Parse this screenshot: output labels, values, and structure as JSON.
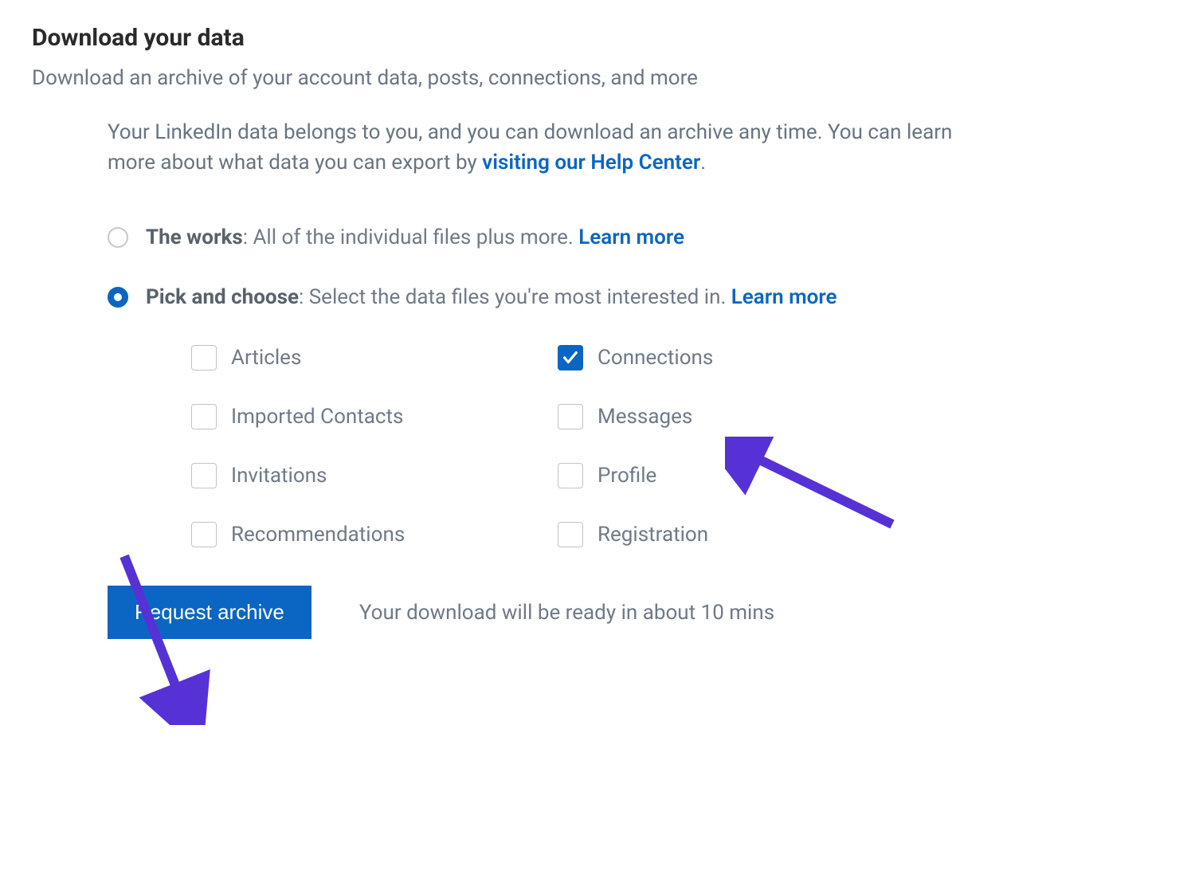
{
  "title": "Download your data",
  "subtitle": "Download an archive of your account data, posts, connections, and more",
  "intro_text_1": "Your LinkedIn data belongs to you, and you can download an archive any time. You can learn more about what data you can export by ",
  "intro_link": "visiting our Help Center",
  "intro_text_2": ".",
  "radio_options": [
    {
      "selected": false,
      "bold": "The works",
      "rest": ": All of the individual files plus more. ",
      "learn_more": "Learn more"
    },
    {
      "selected": true,
      "bold": "Pick and choose",
      "rest": ": Select the data files you're most interested in. ",
      "learn_more": "Learn more"
    }
  ],
  "checkboxes": [
    {
      "label": "Articles",
      "checked": false
    },
    {
      "label": "Connections",
      "checked": true
    },
    {
      "label": "Imported Contacts",
      "checked": false
    },
    {
      "label": "Messages",
      "checked": false
    },
    {
      "label": "Invitations",
      "checked": false
    },
    {
      "label": "Profile",
      "checked": false
    },
    {
      "label": "Recommendations",
      "checked": false
    },
    {
      "label": "Registration",
      "checked": false
    }
  ],
  "button_label": "Request archive",
  "footer_text": "Your download will be ready in about 10 mins",
  "colors": {
    "accent": "#0a66c2",
    "arrow": "#5632d6"
  }
}
